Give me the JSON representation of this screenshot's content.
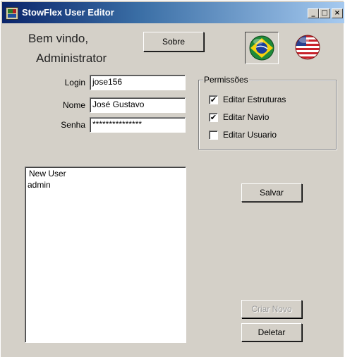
{
  "window": {
    "title": "StowFlex User Editor"
  },
  "title_buttons": {
    "minimize": "_",
    "maximize": "□",
    "close": "×"
  },
  "welcome": {
    "line1": "Bem vindo,",
    "line2": "Administrator"
  },
  "about_button": "Sobre",
  "flags": {
    "brazil": "brazil-flag-icon",
    "usa": "usa-flag-icon"
  },
  "form": {
    "login": {
      "label": "Login",
      "value": "jose156"
    },
    "nome": {
      "label": "Nome",
      "value": "José Gustavo"
    },
    "senha": {
      "label": "Senha",
      "value": "***************"
    }
  },
  "permissions": {
    "title": "Permissões",
    "items": [
      {
        "label": "Editar Estruturas",
        "checked": true
      },
      {
        "label": "Editar Navio",
        "checked": true
      },
      {
        "label": "Editar Usuario",
        "checked": false
      }
    ]
  },
  "user_list": {
    "items": [
      "New User",
      "admin"
    ]
  },
  "buttons": {
    "save": "Salvar",
    "new": "Criar Novo",
    "delete": "Deletar"
  },
  "colors": {
    "window_bg": "#d4d0c8",
    "titlebar": "#0a246a"
  }
}
